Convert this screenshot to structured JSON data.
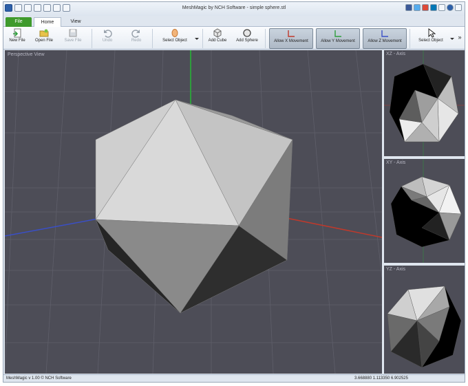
{
  "window": {
    "title": "MeshMagic by NCH Software - simple sphere.stl"
  },
  "tabs": [
    {
      "label": "File"
    },
    {
      "label": "Home"
    },
    {
      "label": "View"
    }
  ],
  "ribbon": {
    "new_file": "New File",
    "open_file": "Open File",
    "save_file": "Save File",
    "undo": "Undo",
    "redo": "Redo",
    "select_object": "Select Object",
    "add_cube": "Add Cube",
    "add_sphere": "Add Sphere",
    "allow_x": "Allow X Movement",
    "allow_y": "Allow Y Movement",
    "allow_z": "Allow Z Movement",
    "select_object_2": "Select Object",
    "more": "»"
  },
  "viewports": {
    "perspective": "Perspective View",
    "xz": "XZ - Axis",
    "xy": "XY - Axis",
    "yz": "YZ - Axis"
  },
  "status": {
    "left": "MeshMagic v 1.00 © NCH Software",
    "coords": "3.668880 1.113350 6.902525"
  },
  "colors": {
    "viewport_bg": "#4d4d57",
    "file_tab": "#3f9a2c",
    "axis_x": "#c0392b",
    "axis_y": "#2e9e3c",
    "axis_z": "#3a4fc7"
  }
}
